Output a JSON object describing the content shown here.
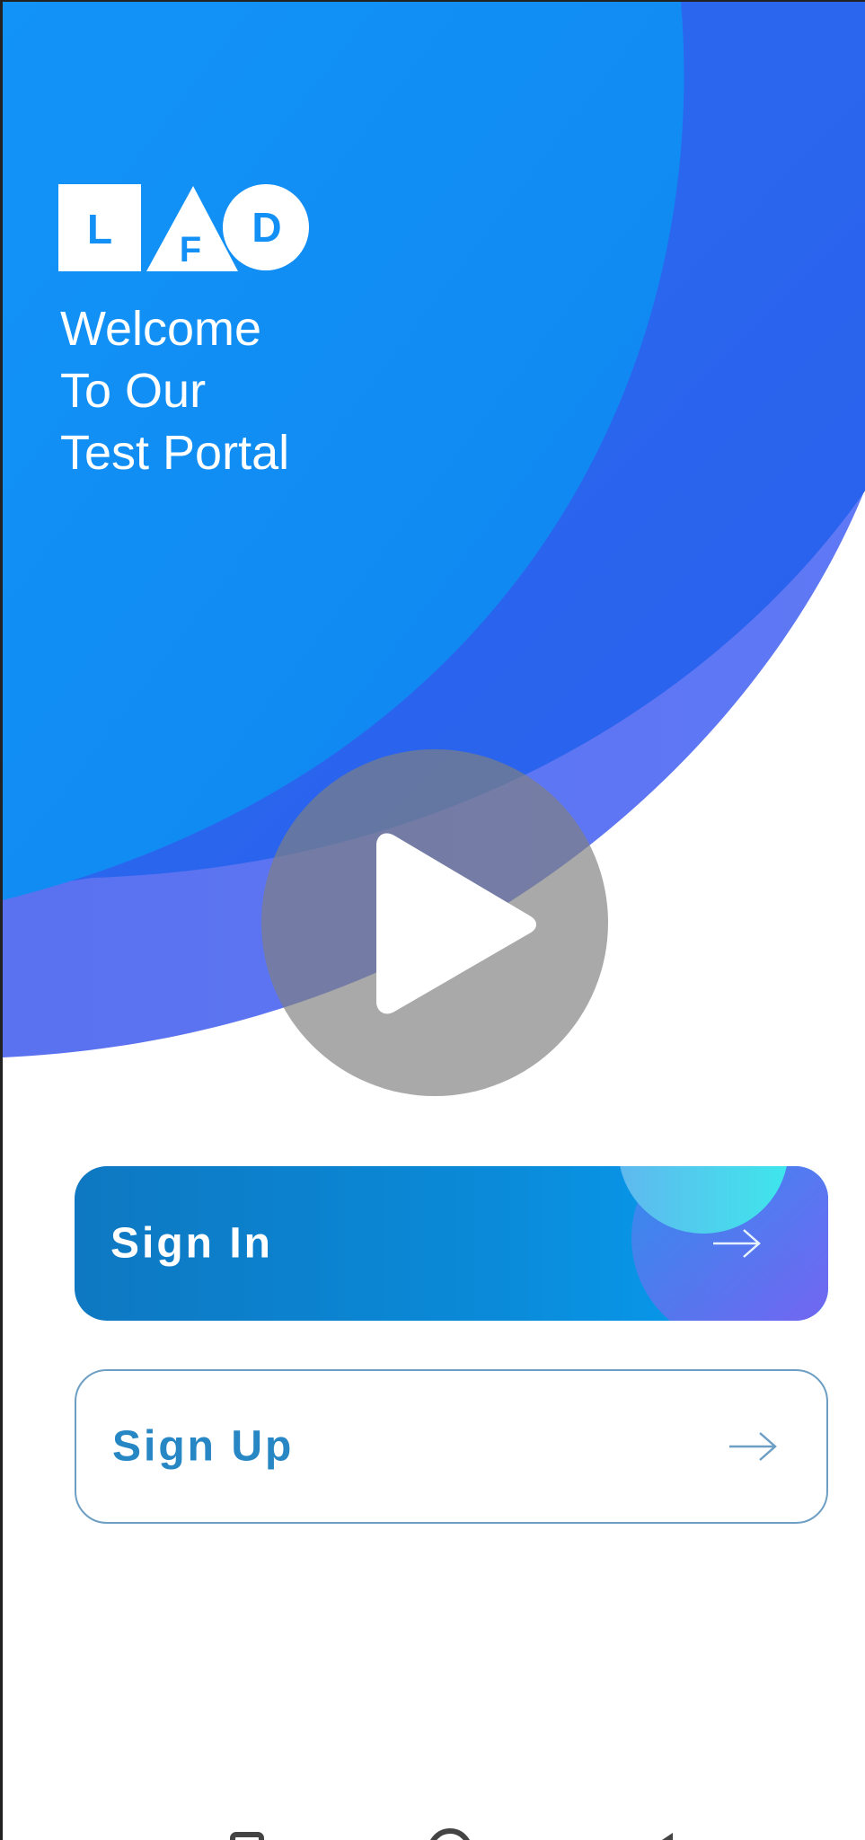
{
  "brand": {
    "logo_letters": [
      "L",
      "F",
      "D"
    ]
  },
  "welcome": {
    "line1": "Welcome",
    "line2": "To Our",
    "line3": "Test Portal"
  },
  "video": {
    "overlay": "play-icon"
  },
  "actions": {
    "sign_in_label": "Sign In",
    "sign_up_label": "Sign Up",
    "arrow_icon": "arrow-right-icon"
  },
  "nav": {
    "recents_icon": "recents-icon",
    "home_icon": "home-icon",
    "back_icon": "back-icon"
  },
  "colors": {
    "primary_blue": "#1288f2",
    "deep_blue": "#2a66ee",
    "violet_blue": "#5a74f0",
    "button_blue": "#0a8ad8",
    "label_blue": "#2786c4"
  }
}
